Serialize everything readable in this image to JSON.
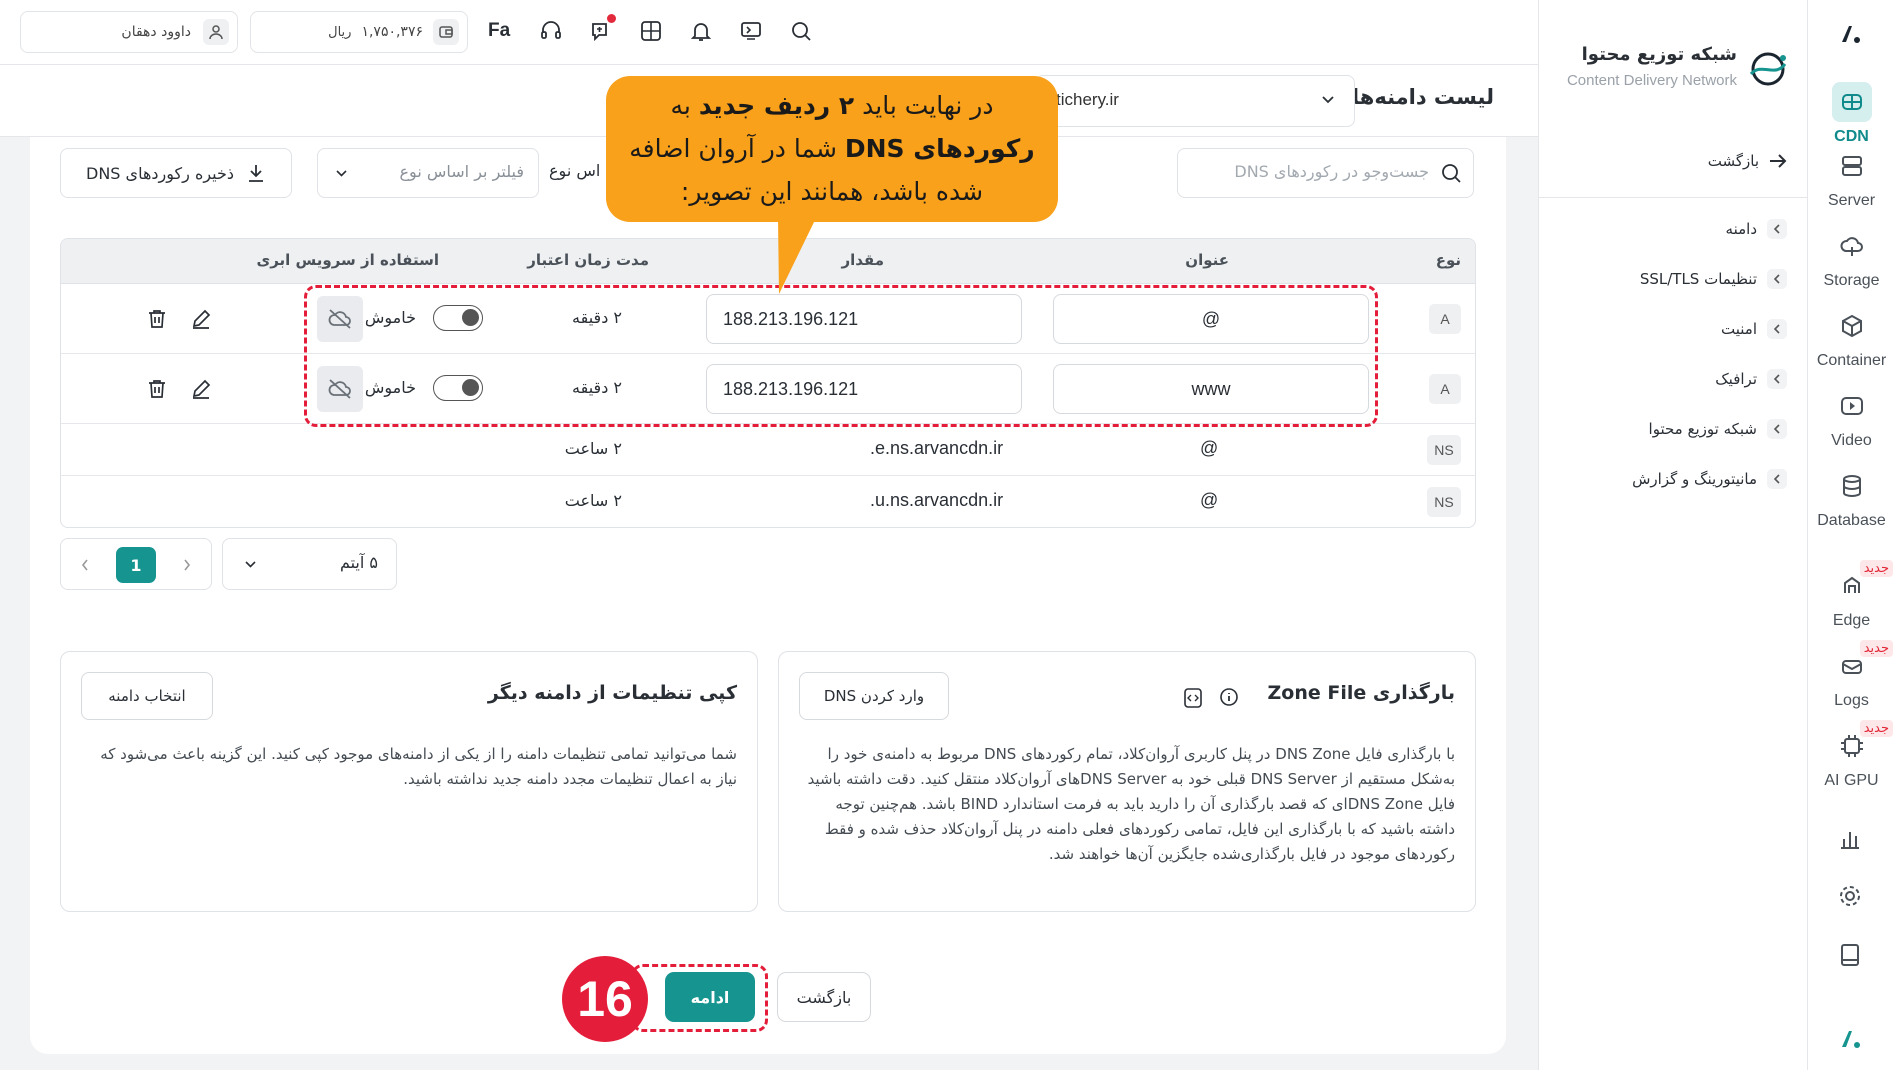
{
  "colors": {
    "accent": "#16948f",
    "annotation": "#e41e3a",
    "callout": "#f9a11b"
  },
  "rail": {
    "items": [
      {
        "label": "CDN",
        "icon": "cdn-icon",
        "active": true
      },
      {
        "label": "Server",
        "icon": "server-icon"
      },
      {
        "label": "Storage",
        "icon": "storage-icon"
      },
      {
        "label": "Container",
        "icon": "container-icon"
      },
      {
        "label": "Video",
        "icon": "video-icon"
      },
      {
        "label": "Database",
        "icon": "database-icon"
      },
      {
        "label": "Edge",
        "icon": "edge-icon",
        "badge": "جدید"
      },
      {
        "label": "Logs",
        "icon": "logs-icon",
        "badge": "جدید"
      },
      {
        "label": "AI GPU",
        "icon": "gpu-icon",
        "badge": "جدید"
      }
    ]
  },
  "sidenav": {
    "title": "شبکه توزیع محتوا",
    "subtitle": "Content Delivery Network",
    "back": "بازگشت",
    "items": [
      "دامنه",
      "تنظیمات SSL/TLS",
      "امنیت",
      "ترافیک",
      "شبکه توزیع محتوا",
      "مانیتورینگ و گزارش"
    ]
  },
  "topbar": {
    "user_name": "داوود دهقان",
    "balance": "۱,۷۵۰,۳۷۶",
    "currency": "ریال",
    "lang": "Fa"
  },
  "header": {
    "title": "لیست دامنه‌ها",
    "domain_value": "tichery.ir"
  },
  "toolbar": {
    "search_placeholder": "جست‌وجو در رکوردهای DNS",
    "filter_label": "اس نوع",
    "filter_placeholder": "فیلتر بر اساس نوع",
    "save_label": "ذخیره رکوردهای DNS"
  },
  "table": {
    "headers": {
      "type": "نوع",
      "name": "عنوان",
      "value": "مقدار",
      "ttl": "مدت زمان اعتبار",
      "cloud": "استفاده از سرویس ابری"
    },
    "rows": [
      {
        "type": "A",
        "name": "@",
        "value": "188.213.196.121",
        "ttl": "۲ دقیقه",
        "cloud": "خاموش"
      },
      {
        "type": "A",
        "name": "www",
        "value": "188.213.196.121",
        "ttl": "۲ دقیقه",
        "cloud": "خاموش"
      },
      {
        "type": "NS",
        "name": "@",
        "value": "e.ns.arvancdn.ir.",
        "ttl": "۲ ساعت"
      },
      {
        "type": "NS",
        "name": "@",
        "value": "u.ns.arvancdn.ir.",
        "ttl": "۲ ساعت"
      }
    ]
  },
  "pagination": {
    "current": "1",
    "per_page": "۵ آیتم"
  },
  "zone": {
    "title": "بارگذاری Zone File",
    "button": "وارد کردن DNS",
    "desc": "با بارگذاری فایل DNS Zone در پنل کاربری آروان‌کلاد، تمام رکوردهای DNS مربوط به دامنه‌ی خود را به‌شکل مستقیم از DNS Server قبلی خود به DNS Serverهای آروان‌کلاد منتقل کنید. دقت داشته باشید فایل DNS Zoneای که قصد بارگذاری آن را دارید باید به فرمت استاندارد BIND باشد. هم‌چنین توجه داشته باشید که با بارگذاری این فایل، تمامی رکوردهای فعلی دامنه در پنل آروان‌کلاد حذف شده و فقط رکوردهای موجود در فایل بارگذاری‌شده جایگزین آن‌ها خواهند شد."
  },
  "copy": {
    "title": "کپی تنظیمات از دامنه دیگر",
    "button": "انتخاب دامنه",
    "desc": "شما می‌توانید تمامی تنظیمات دامنه را از یکی از دامنه‌های موجود کپی کنید. این گزینه باعث می‌شود که نیاز به اعمال تنظیمات مجدد دامنه جدید نداشته باشید."
  },
  "footer": {
    "continue": "ادامه",
    "back": "بازگشت"
  },
  "annotation": {
    "step": "16",
    "callout_line1a": "در نهایت باید ",
    "callout_bold1": "۲ ردیف جدید",
    "callout_line1b": " به",
    "callout_bold2": "رکوردهای DNS",
    "callout_line2": " شما در آروان اضافه",
    "callout_line3": "شده باشد، همانند این تصویر:"
  }
}
